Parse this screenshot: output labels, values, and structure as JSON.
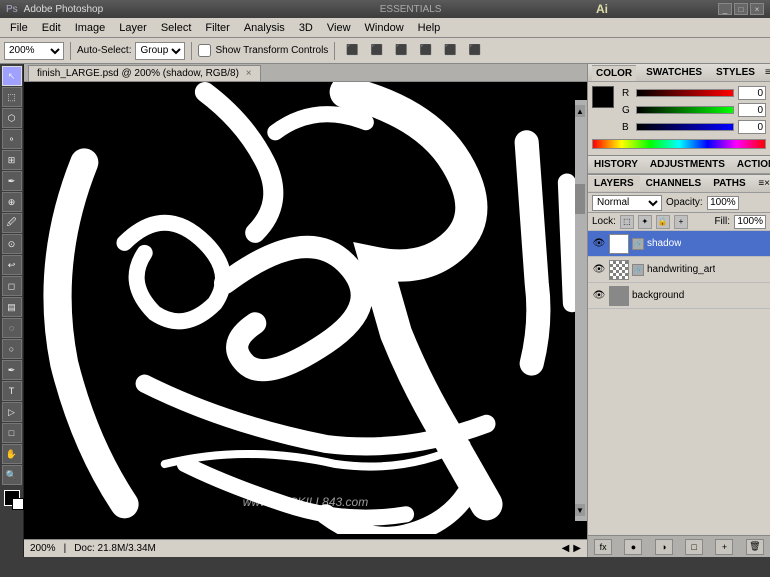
{
  "titleBar": {
    "title": "Adobe Photoshop",
    "mode": "ESSENTIALS",
    "buttons": [
      "_",
      "□",
      "×"
    ]
  },
  "aiPanel": {
    "title": "Ai",
    "buttons": [
      "_",
      "□",
      "×"
    ]
  },
  "menuBar": {
    "items": [
      "File",
      "Edit",
      "Image",
      "Layer",
      "Select",
      "Filter",
      "Analysis",
      "3D",
      "View",
      "Window",
      "Help"
    ]
  },
  "toolbar": {
    "autoSelectLabel": "Auto-Select:",
    "groupLabel": "Group",
    "showTransformControls": "Show Transform Controls",
    "zoomLevel": "200%"
  },
  "canvasTab": {
    "title": "finish_LARGE.psd @ 200% (shadow, RGB/8)",
    "closeBtn": "×"
  },
  "canvas": {
    "watermark": "www.NOSKILL843.com",
    "zoom": "200%",
    "docInfo": "Doc: 21.8M/3.34M"
  },
  "colorPanel": {
    "tabs": [
      "COLOR",
      "SWATCHES",
      "STYLES"
    ],
    "activeTab": "COLOR",
    "sliders": [
      {
        "label": "R",
        "value": 0
      },
      {
        "label": "G",
        "value": 0
      },
      {
        "label": "B",
        "value": 0
      }
    ]
  },
  "historyPanel": {
    "tabs": [
      "HISTORY",
      "ADJUSTMENTS",
      "ACTIONS"
    ]
  },
  "layersPanel": {
    "tabs": [
      "LAYERS",
      "CHANNELS",
      "PATHS"
    ],
    "blendMode": "Normal",
    "opacityLabel": "Opacity:",
    "opacityValue": "100%",
    "lockLabel": "Lock:",
    "fillLabel": "Fill:",
    "fillValue": "100%",
    "layers": [
      {
        "name": "shadow",
        "visible": true,
        "active": true,
        "thumbType": "white"
      },
      {
        "name": "handwriting_art",
        "visible": true,
        "active": false,
        "thumbType": "checker"
      },
      {
        "name": "background",
        "visible": true,
        "active": false,
        "thumbType": "gray"
      }
    ],
    "footerButtons": [
      "fx",
      "●",
      "□",
      "▼",
      "🗑"
    ]
  },
  "statusBar": {
    "zoom": "200%",
    "docInfo": "Doc: 21.8M/3.34M"
  },
  "leftTools": {
    "tools": [
      "↖",
      "✂",
      "⬚",
      "⬡",
      "🖉",
      "⌖",
      "✒",
      "⬛",
      "⟳",
      "T",
      "🔍",
      "✋",
      "🖼",
      "⬤",
      "◑",
      "⚡",
      "🔧",
      "💧",
      "✦",
      "🖊",
      "⬡",
      "🔍"
    ]
  }
}
